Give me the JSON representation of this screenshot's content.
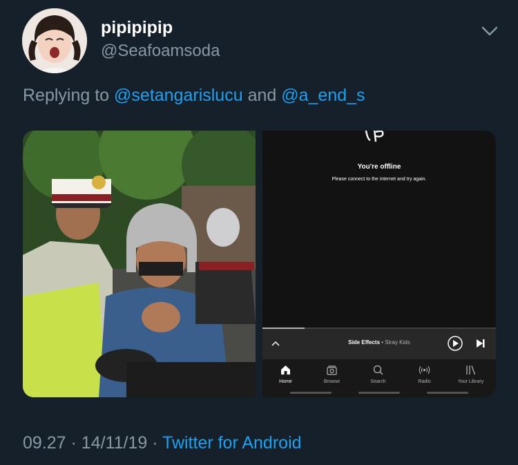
{
  "tweet": {
    "display_name": "pipipipip",
    "handle": "@Seafoamsoda",
    "reply_prefix": "Replying to",
    "reply_mention_1": "@setangarislucu",
    "reply_conjunction": "and",
    "reply_mention_2": "@a_end_s",
    "time": "09.27",
    "separator": "·",
    "date": "14/11/19",
    "source": "Twitter for Android"
  },
  "screenshot": {
    "offline_title": "You're offline",
    "offline_message": "Please connect to the internet and try again.",
    "now_playing_title": "Side Effects",
    "now_playing_separator": " • ",
    "now_playing_artist": "Stray Kids",
    "progress_fraction": 0.18,
    "tabs": [
      {
        "label": "Home",
        "icon": "home-icon",
        "active": true
      },
      {
        "label": "Browse",
        "icon": "browse-icon",
        "active": false
      },
      {
        "label": "Search",
        "icon": "search-icon",
        "active": false
      },
      {
        "label": "Radio",
        "icon": "radio-icon",
        "active": false
      },
      {
        "label": "Your Library",
        "icon": "library-icon",
        "active": false
      }
    ]
  },
  "colors": {
    "background": "#15202b",
    "secondary_text": "#8899a6",
    "link": "#1da1f2",
    "player_bg": "#282828",
    "tabbar_bg": "#181818"
  }
}
